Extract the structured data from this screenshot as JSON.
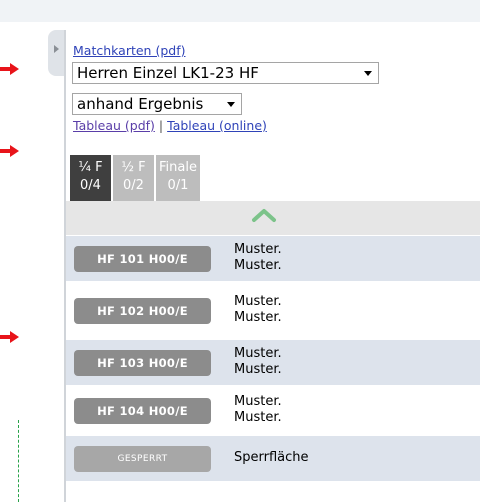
{
  "links": {
    "matchkarten": "Matchkarten (pdf)",
    "tableau_pdf": "Tableau (pdf)",
    "separator": "|",
    "tableau_online": "Tableau (online)"
  },
  "selects": {
    "competition": "Herren Einzel LK1-23 HF",
    "sort": "anhand Ergebnis"
  },
  "tabs": [
    {
      "label": "¼ F",
      "count": "0/4",
      "active": true
    },
    {
      "label": "½ F",
      "count": "0/2",
      "active": false
    },
    {
      "label": "Finale",
      "count": "0/1",
      "active": false
    }
  ],
  "matches": [
    {
      "code": "HF 101 H00/E",
      "player1": "Muster.",
      "player2": "Muster."
    },
    {
      "code": "HF 102 H00/E",
      "player1": "Muster.",
      "player2": "Muster."
    },
    {
      "code": "HF 103 H00/E",
      "player1": "Muster.",
      "player2": "Muster."
    },
    {
      "code": "HF 104 H00/E",
      "player1": "Muster.",
      "player2": "Muster."
    }
  ],
  "locked": {
    "code": "GESPERRT",
    "label": "Sperrfläche"
  },
  "colors": {
    "arrow": "#e8141a",
    "tab_active": "#3f3f3f",
    "tab_inactive": "#bdbdbd",
    "button": "#8c8c8c",
    "row_alt": "#dde3ec",
    "chevron": "#7cc38a",
    "link": "#2f43b8"
  }
}
